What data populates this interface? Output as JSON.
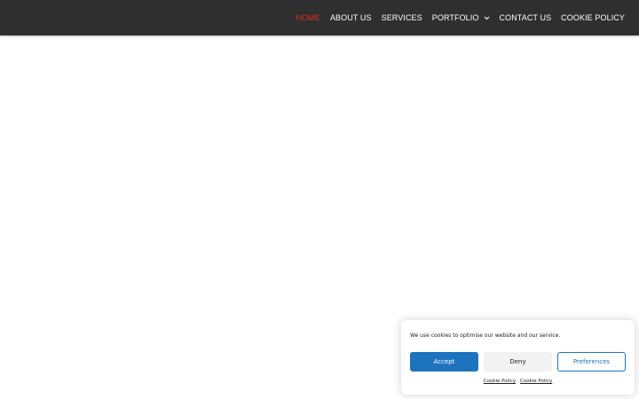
{
  "nav": {
    "items": [
      {
        "label": "HOME",
        "active": true
      },
      {
        "label": "ABOUT US",
        "active": false
      },
      {
        "label": "SERVICES",
        "active": false
      },
      {
        "label": "PORTFOLIO",
        "active": false,
        "has_dropdown": true
      },
      {
        "label": "CONTACT US",
        "active": false
      },
      {
        "label": "COOKIE POLICY",
        "active": false
      }
    ],
    "dropdown_icon": "chevron-down-icon"
  },
  "cookie_banner": {
    "message": "We use cookies to optimise our website and our service.",
    "accept_label": "Accept",
    "deny_label": "Deny",
    "preferences_label": "Preferences",
    "links": [
      "Cookie Policy",
      "Cookie Policy"
    ]
  },
  "colors": {
    "navbar_bg": "#2f2f2f",
    "nav_text": "#ffffff",
    "nav_active": "#e02b20",
    "accent": "#1e73be",
    "deny_bg": "#f2f2f2"
  }
}
